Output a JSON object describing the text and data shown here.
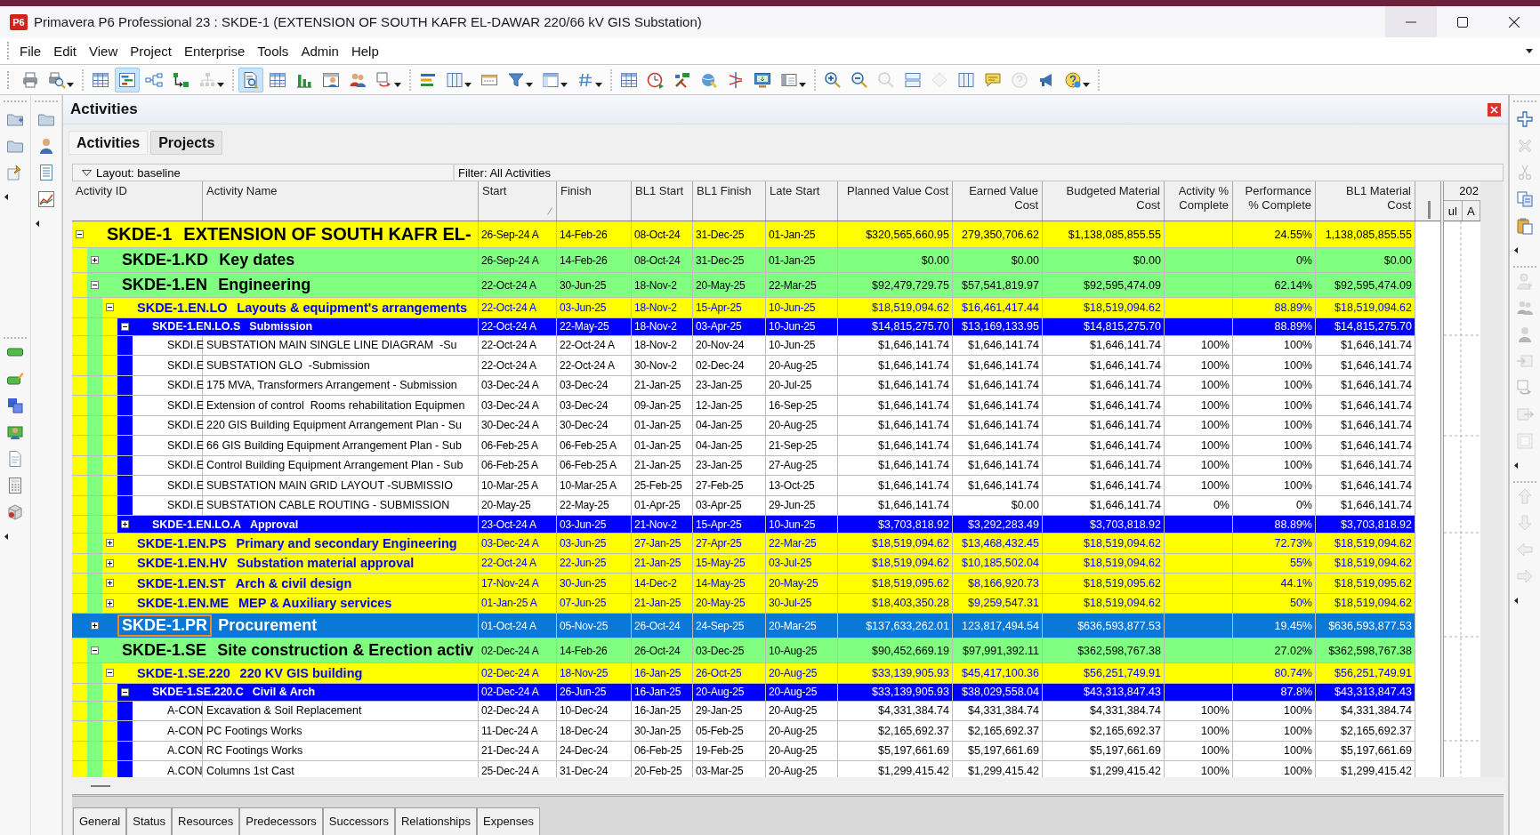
{
  "window": {
    "logo": "P6",
    "title": "Primavera P6 Professional 23 : SKDE-1 (EXTENSION OF SOUTH KAFR EL-DAWAR 220/66 kV GIS Substation)"
  },
  "menu": [
    "File",
    "Edit",
    "View",
    "Project",
    "Enterprise",
    "Tools",
    "Admin",
    "Help"
  ],
  "toolbar": [
    [
      {
        "pressed": false,
        "disabled": false,
        "dropdown": false
      },
      {
        "pressed": false,
        "disabled": false,
        "dropdown": true
      }
    ],
    [
      {
        "pressed": false,
        "disabled": false,
        "dropdown": false
      },
      {
        "pressed": true,
        "disabled": false,
        "dropdown": false
      },
      {
        "pressed": false,
        "disabled": false,
        "dropdown": false
      },
      {
        "pressed": false,
        "disabled": false,
        "dropdown": false
      },
      {
        "pressed": false,
        "disabled": true,
        "dropdown": true
      }
    ],
    [
      {
        "pressed": true,
        "disabled": false,
        "dropdown": false
      },
      {
        "pressed": false,
        "disabled": false,
        "dropdown": false
      },
      {
        "pressed": false,
        "disabled": false,
        "dropdown": false
      },
      {
        "pressed": false,
        "disabled": false,
        "dropdown": false
      },
      {
        "pressed": false,
        "disabled": false,
        "dropdown": false
      },
      {
        "pressed": false,
        "disabled": false,
        "dropdown": true
      }
    ],
    [
      {
        "pressed": false,
        "disabled": false,
        "dropdown": false
      },
      {
        "pressed": false,
        "disabled": false,
        "dropdown": true
      },
      {
        "pressed": false,
        "disabled": false,
        "dropdown": false
      },
      {
        "pressed": false,
        "disabled": false,
        "dropdown": true
      },
      {
        "pressed": false,
        "disabled": false,
        "dropdown": true
      },
      {
        "pressed": false,
        "disabled": false,
        "dropdown": true
      }
    ],
    [
      {
        "pressed": false,
        "disabled": false,
        "dropdown": false
      },
      {
        "pressed": false,
        "disabled": false,
        "dropdown": false
      },
      {
        "pressed": false,
        "disabled": false,
        "dropdown": false
      },
      {
        "pressed": false,
        "disabled": false,
        "dropdown": false
      },
      {
        "pressed": false,
        "disabled": false,
        "dropdown": false
      },
      {
        "pressed": false,
        "disabled": false,
        "dropdown": false
      },
      {
        "pressed": false,
        "disabled": false,
        "dropdown": true
      }
    ],
    [
      {
        "pressed": false,
        "disabled": false,
        "dropdown": false
      },
      {
        "pressed": false,
        "disabled": false,
        "dropdown": false
      },
      {
        "pressed": false,
        "disabled": true,
        "dropdown": false
      },
      {
        "pressed": false,
        "disabled": false,
        "dropdown": false
      },
      {
        "pressed": false,
        "disabled": true,
        "dropdown": false
      },
      {
        "pressed": false,
        "disabled": false,
        "dropdown": false
      },
      {
        "pressed": false,
        "disabled": false,
        "dropdown": false
      },
      {
        "pressed": false,
        "disabled": true,
        "dropdown": false
      },
      {
        "pressed": false,
        "disabled": false,
        "dropdown": false
      },
      {
        "pressed": false,
        "disabled": false,
        "dropdown": true
      }
    ]
  ],
  "left_dock": [
    [
      [
        {
          "disabled": false
        },
        {
          "disabled": false
        },
        {
          "disabled": false
        }
      ],
      [
        {
          "disabled": false
        },
        {
          "disabled": false
        },
        {
          "disabled": false
        },
        {
          "disabled": false
        },
        {
          "disabled": false
        },
        {
          "disabled": false
        },
        {
          "disabled": false
        }
      ]
    ],
    [
      [
        {
          "disabled": false
        },
        {
          "disabled": false
        },
        {
          "disabled": false
        },
        {
          "disabled": false
        }
      ]
    ]
  ],
  "right_dock": [
    [
      {
        "disabled": false
      },
      {
        "disabled": true
      },
      {
        "disabled": true
      },
      {
        "disabled": false
      },
      {
        "disabled": false
      }
    ],
    [
      {
        "disabled": true
      },
      {
        "disabled": true
      },
      {
        "disabled": true
      },
      {
        "disabled": true
      },
      {
        "disabled": true
      },
      {
        "disabled": true
      },
      {
        "disabled": true
      }
    ],
    [
      {
        "disabled": true
      },
      {
        "disabled": true
      },
      {
        "disabled": true
      },
      {
        "disabled": true
      }
    ]
  ],
  "panel": {
    "title": "Activities",
    "tabs": [
      {
        "label": "Activities",
        "selected": true
      },
      {
        "label": "Projects",
        "selected": false
      }
    ]
  },
  "layout_bar": {
    "layout": "Layout: baseline",
    "filter": "Filter: All Activities"
  },
  "table": {
    "columns": [
      {
        "label": "Activity ID",
        "sorted": false
      },
      {
        "label": "Activity Name",
        "sorted": false
      },
      {
        "label": "Start",
        "sorted": true
      },
      {
        "label": "Finish",
        "sorted": false
      },
      {
        "label": "BL1 Start",
        "sorted": false
      },
      {
        "label": "BL1 Finish",
        "sorted": false
      },
      {
        "label": "Late Start",
        "sorted": false
      },
      {
        "label": "Planned Value Cost",
        "sorted": false
      },
      {
        "label": "Earned Value\nCost",
        "sorted": false
      },
      {
        "label": "Budgeted Material\nCost",
        "sorted": false
      },
      {
        "label": "Activity %\nComplete",
        "sorted": false
      },
      {
        "label": "Performance\n% Complete",
        "sorted": false
      },
      {
        "label": "BL1 Material\nCost",
        "sorted": false
      }
    ],
    "rows": [
      {
        "kind": "wbs",
        "expanded": true,
        "selected": false,
        "cells": [
          "SKDE-1",
          "EXTENSION OF SOUTH KAFR EL-",
          "26-Sep-24 A",
          "14-Feb-26",
          "08-Oct-24",
          "31-Dec-25",
          "01-Jan-25",
          "$320,565,660.95",
          "279,350,706.62",
          "$1,138,085,855.55",
          null,
          "24.55%",
          "1,138,085,855.55"
        ],
        "children": [
          {
            "kind": "wbs",
            "expanded": false,
            "selected": false,
            "cells": [
              "SKDE-1.KD",
              "Key dates",
              "26-Sep-24 A",
              "14-Feb-26",
              "08-Oct-24",
              "31-Dec-25",
              "01-Jan-25",
              "$0.00",
              "$0.00",
              "$0.00",
              null,
              "0%",
              "$0.00"
            ]
          },
          {
            "kind": "wbs",
            "expanded": true,
            "selected": false,
            "cells": [
              "SKDE-1.EN",
              "Engineering",
              "22-Oct-24 A",
              "30-Jun-25",
              "18-Nov-2",
              "20-May-25",
              "22-Mar-25",
              "$92,479,729.75",
              "$57,541,819.97",
              "$92,595,474.09",
              null,
              "62.14%",
              "$92,595,474.09"
            ],
            "children": [
              {
                "kind": "wbs",
                "expanded": true,
                "selected": false,
                "cells": [
                  "SKDE-1.EN.LO",
                  "Layouts & equipment's arrangements",
                  "22-Oct-24 A",
                  "03-Jun-25",
                  "18-Nov-2",
                  "15-Apr-25",
                  "10-Jun-25",
                  "$18,519,094.62",
                  "$16,461,417.44",
                  "$18,519,094.62",
                  null,
                  "88.89%",
                  "$18,519,094.62"
                ],
                "children": [
                  {
                    "kind": "wbs",
                    "expanded": true,
                    "selected": false,
                    "cells": [
                      "SKDE-1.EN.LO.S",
                      "Submission",
                      "22-Oct-24 A",
                      "22-May-25",
                      "18-Nov-2",
                      "03-Apr-25",
                      "10-Jun-25",
                      "$14,815,275.70",
                      "$13,169,133.95",
                      "$14,815,275.70",
                      null,
                      "88.89%",
                      "$14,815,275.70"
                    ],
                    "children": [
                      {
                        "kind": "activity",
                        "selected": false,
                        "cells": [
                          "SKDI.E",
                          "SUBSTATION MAIN SINGLE LINE DIAGRAM  -Su",
                          "22-Oct-24 A",
                          "22-Oct-24 A",
                          "18-Nov-2",
                          "20-Nov-24",
                          "10-Jun-25",
                          "$1,646,141.74",
                          "$1,646,141.74",
                          "$1,646,141.74",
                          "100%",
                          "100%",
                          "$1,646,141.74"
                        ]
                      },
                      {
                        "kind": "activity",
                        "selected": false,
                        "cells": [
                          "SKDI.E",
                          "SUBSTATION GLO  -Submission",
                          "22-Oct-24 A",
                          "22-Oct-24 A",
                          "30-Nov-2",
                          "02-Dec-24",
                          "20-Aug-25",
                          "$1,646,141.74",
                          "$1,646,141.74",
                          "$1,646,141.74",
                          "100%",
                          "100%",
                          "$1,646,141.74"
                        ]
                      },
                      {
                        "kind": "activity",
                        "selected": false,
                        "cells": [
                          "SKDI.E",
                          "175 MVA, Transformers Arrangement - Submission",
                          "03-Dec-24 A",
                          "03-Dec-24",
                          "21-Jan-25",
                          "23-Jan-25",
                          "20-Jul-25",
                          "$1,646,141.74",
                          "$1,646,141.74",
                          "$1,646,141.74",
                          "100%",
                          "100%",
                          "$1,646,141.74"
                        ]
                      },
                      {
                        "kind": "activity",
                        "selected": false,
                        "cells": [
                          "SKDI.E",
                          "Extension of control  Rooms rehabilitation Equipmen",
                          "03-Dec-24 A",
                          "03-Dec-24",
                          "09-Jan-25",
                          "12-Jan-25",
                          "16-Sep-25",
                          "$1,646,141.74",
                          "$1,646,141.74",
                          "$1,646,141.74",
                          "100%",
                          "100%",
                          "$1,646,141.74"
                        ]
                      },
                      {
                        "kind": "activity",
                        "selected": false,
                        "cells": [
                          "SKDI.E",
                          "220 GIS Building Equipment Arrangement Plan - Su",
                          "30-Dec-24 A",
                          "30-Dec-24",
                          "01-Jan-25",
                          "04-Jan-25",
                          "20-Aug-25",
                          "$1,646,141.74",
                          "$1,646,141.74",
                          "$1,646,141.74",
                          "100%",
                          "100%",
                          "$1,646,141.74"
                        ]
                      },
                      {
                        "kind": "activity",
                        "selected": false,
                        "cells": [
                          "SKDI.E",
                          "66 GIS Building Equipment Arrangement Plan - Sub",
                          "06-Feb-25 A",
                          "06-Feb-25 A",
                          "01-Jan-25",
                          "04-Jan-25",
                          "21-Sep-25",
                          "$1,646,141.74",
                          "$1,646,141.74",
                          "$1,646,141.74",
                          "100%",
                          "100%",
                          "$1,646,141.74"
                        ]
                      },
                      {
                        "kind": "activity",
                        "selected": false,
                        "cells": [
                          "SKDI.E",
                          "Control Building Equipment Arrangement Plan - Sub",
                          "06-Feb-25 A",
                          "06-Feb-25 A",
                          "21-Jan-25",
                          "23-Jan-25",
                          "27-Aug-25",
                          "$1,646,141.74",
                          "$1,646,141.74",
                          "$1,646,141.74",
                          "100%",
                          "100%",
                          "$1,646,141.74"
                        ]
                      },
                      {
                        "kind": "activity",
                        "selected": false,
                        "cells": [
                          "SKDI.E",
                          "SUBSTATION MAIN GRID LAYOUT -SUBMISSIO",
                          "10-Mar-25 A",
                          "10-Mar-25 A",
                          "25-Feb-25",
                          "27-Feb-25",
                          "13-Oct-25",
                          "$1,646,141.74",
                          "$1,646,141.74",
                          "$1,646,141.74",
                          "100%",
                          "100%",
                          "$1,646,141.74"
                        ]
                      },
                      {
                        "kind": "activity",
                        "selected": false,
                        "cells": [
                          "SKDI.E",
                          "SUBSTATION CABLE ROUTING - SUBMISSION",
                          "20-May-25",
                          "22-May-25",
                          "01-Apr-25",
                          "03-Apr-25",
                          "29-Jun-25",
                          "$1,646,141.74",
                          "$0.00",
                          "$1,646,141.74",
                          "0%",
                          "0%",
                          "$1,646,141.74"
                        ]
                      }
                    ]
                  },
                  {
                    "kind": "wbs",
                    "expanded": false,
                    "selected": false,
                    "cells": [
                      "SKDE-1.EN.LO.A",
                      "Approval",
                      "23-Oct-24 A",
                      "03-Jun-25",
                      "21-Nov-2",
                      "15-Apr-25",
                      "10-Jun-25",
                      "$3,703,818.92",
                      "$3,292,283.49",
                      "$3,703,818.92",
                      null,
                      "88.89%",
                      "$3,703,818.92"
                    ]
                  }
                ]
              },
              {
                "kind": "wbs",
                "expanded": false,
                "selected": false,
                "cells": [
                  "SKDE-1.EN.PS",
                  "Primary and secondary Engineering",
                  "03-Dec-24 A",
                  "03-Jun-25",
                  "27-Jan-25",
                  "27-Apr-25",
                  "22-Mar-25",
                  "$18,519,094.62",
                  "$13,468,432.45",
                  "$18,519,094.62",
                  null,
                  "72.73%",
                  "$18,519,094.62"
                ]
              },
              {
                "kind": "wbs",
                "expanded": false,
                "selected": false,
                "cells": [
                  "SKDE-1.EN.HV",
                  "Substation material approval",
                  "22-Oct-24 A",
                  "22-Jun-25",
                  "21-Jan-25",
                  "15-May-25",
                  "03-Jul-25",
                  "$18,519,094.62",
                  "$10,185,502.04",
                  "$18,519,094.62",
                  null,
                  "55%",
                  "$18,519,094.62"
                ]
              },
              {
                "kind": "wbs",
                "expanded": false,
                "selected": false,
                "cells": [
                  "SKDE-1.EN.ST",
                  "Arch & civil design",
                  "17-Nov-24 A",
                  "30-Jun-25",
                  "14-Dec-2",
                  "14-May-25",
                  "20-May-25",
                  "$18,519,095.62",
                  "$8,166,920.73",
                  "$18,519,095.62",
                  null,
                  "44.1%",
                  "$18,519,095.62"
                ]
              },
              {
                "kind": "wbs",
                "expanded": false,
                "selected": false,
                "cells": [
                  "SKDE-1.EN.ME",
                  "MEP & Auxiliary services",
                  "01-Jan-25 A",
                  "07-Jun-25",
                  "21-Jan-25",
                  "20-May-25",
                  "30-Jul-25",
                  "$18,403,350.28",
                  "$9,259,547.31",
                  "$18,519,094.62",
                  null,
                  "50%",
                  "$18,519,094.62"
                ]
              }
            ]
          },
          {
            "kind": "wbs",
            "expanded": false,
            "selected": true,
            "cells": [
              "SKDE-1.PR",
              "Procurement",
              "01-Oct-24 A",
              "05-Nov-25",
              "26-Oct-24",
              "24-Sep-25",
              "20-Mar-25",
              "$137,633,262.01",
              "123,817,494.54",
              "$636,593,877.53",
              null,
              "19.45%",
              "$636,593,877.53"
            ]
          },
          {
            "kind": "wbs",
            "expanded": true,
            "selected": false,
            "cells": [
              "SKDE-1.SE",
              "Site construction & Erection activ",
              "02-Dec-24 A",
              "14-Feb-26",
              "26-Oct-24",
              "03-Dec-25",
              "10-Aug-25",
              "$90,452,669.19",
              "$97,991,392.11",
              "$362,598,767.38",
              null,
              "27.02%",
              "$362,598,767.38"
            ],
            "children": [
              {
                "kind": "wbs",
                "expanded": true,
                "selected": false,
                "cells": [
                  "SKDE-1.SE.220",
                  "220 KV GIS building",
                  "02-Dec-24 A",
                  "18-Nov-25",
                  "16-Jan-25",
                  "26-Oct-25",
                  "20-Aug-25",
                  "$33,139,905.93",
                  "$45,417,100.36",
                  "$56,251,749.91",
                  null,
                  "80.74%",
                  "$56,251,749.91"
                ],
                "children": [
                  {
                    "kind": "wbs",
                    "expanded": true,
                    "selected": false,
                    "cells": [
                      "SKDE-1.SE.220.C",
                      "Civil & Arch",
                      "02-Dec-24 A",
                      "26-Jun-25",
                      "16-Jan-25",
                      "20-Aug-25",
                      "20-Aug-25",
                      "$33,139,905.93",
                      "$38,029,558.04",
                      "$43,313,847.43",
                      null,
                      "87.8%",
                      "$43,313,847.43"
                    ],
                    "children": [
                      {
                        "kind": "activity",
                        "selected": false,
                        "cells": [
                          "A-CON",
                          "Excavation & Soil Replacement",
                          "02-Dec-24 A",
                          "10-Dec-24",
                          "16-Jan-25",
                          "29-Jan-25",
                          "20-Aug-25",
                          "$4,331,384.74",
                          "$4,331,384.74",
                          "$4,331,384.74",
                          "100%",
                          "100%",
                          "$4,331,384.74"
                        ]
                      },
                      {
                        "kind": "activity",
                        "selected": false,
                        "cells": [
                          "A-CON",
                          "PC Footings Works",
                          "11-Dec-24 A",
                          "18-Dec-24",
                          "30-Jan-25",
                          "05-Feb-25",
                          "20-Aug-25",
                          "$2,165,692.37",
                          "$2,165,692.37",
                          "$2,165,692.37",
                          "100%",
                          "100%",
                          "$2,165,692.37"
                        ]
                      },
                      {
                        "kind": "activity",
                        "selected": false,
                        "cells": [
                          "A.CON",
                          "RC Footings Works",
                          "21-Dec-24 A",
                          "24-Dec-24",
                          "06-Feb-25",
                          "19-Feb-25",
                          "20-Aug-25",
                          "$5,197,661.69",
                          "$5,197,661.69",
                          "$5,197,661.69",
                          "100%",
                          "100%",
                          "$5,197,661.69"
                        ]
                      },
                      {
                        "kind": "activity",
                        "selected": false,
                        "cells": [
                          "A.CON",
                          "Columns 1st Cast",
                          "25-Dec-24 A",
                          "31-Dec-24",
                          "20-Feb-25",
                          "03-Mar-25",
                          "20-Aug-25",
                          "$1,299,415.42",
                          "$1,299,415.42",
                          "$1,299,415.42",
                          "100%",
                          "100%",
                          "$1,299,415.42"
                        ]
                      }
                    ]
                  }
                ]
              }
            ]
          }
        ]
      }
    ]
  },
  "gantt": {
    "year": "202",
    "months": [
      "ul",
      "A"
    ]
  },
  "detail_tabs": [
    "General",
    "Status",
    "Resources",
    "Predecessors",
    "Successors",
    "Relationships",
    "Expenses"
  ]
}
